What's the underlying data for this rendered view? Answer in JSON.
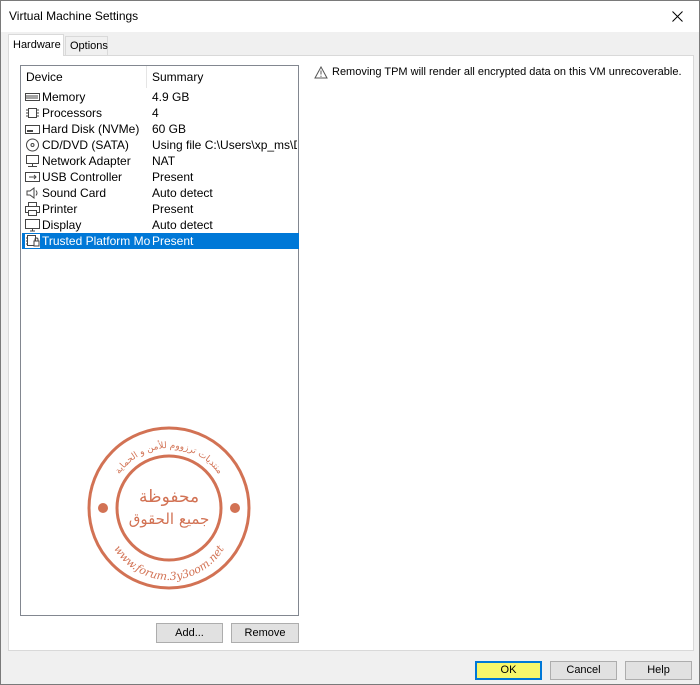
{
  "window": {
    "title": "Virtual Machine Settings"
  },
  "tabs": [
    {
      "label": "Hardware"
    },
    {
      "label": "Options"
    }
  ],
  "list": {
    "headers": {
      "device": "Device",
      "summary": "Summary"
    },
    "rows": [
      {
        "icon": "memory-icon",
        "device": "Memory",
        "summary": "4.9 GB"
      },
      {
        "icon": "processor-icon",
        "device": "Processors",
        "summary": "4"
      },
      {
        "icon": "hard-disk-icon",
        "device": "Hard Disk (NVMe)",
        "summary": "60 GB"
      },
      {
        "icon": "cd-dvd-icon",
        "device": "CD/DVD (SATA)",
        "summary": "Using file C:\\Users\\xp_ms\\D..."
      },
      {
        "icon": "network-adapter-icon",
        "device": "Network Adapter",
        "summary": "NAT"
      },
      {
        "icon": "usb-icon",
        "device": "USB Controller",
        "summary": "Present"
      },
      {
        "icon": "sound-card-icon",
        "device": "Sound Card",
        "summary": "Auto detect"
      },
      {
        "icon": "printer-icon",
        "device": "Printer",
        "summary": "Present"
      },
      {
        "icon": "display-icon",
        "device": "Display",
        "summary": "Auto detect"
      },
      {
        "icon": "tpm-icon",
        "device": "Trusted Platform Mo...",
        "summary": "Present",
        "selected": true
      }
    ]
  },
  "buttons": {
    "add": "Add...",
    "remove": "Remove",
    "ok": "OK",
    "cancel": "Cancel",
    "help": "Help"
  },
  "warning": {
    "icon": "warning-icon",
    "text": "Removing TPM will render all encrypted data on this VM unrecoverable."
  },
  "watermark": {
    "line1": "منتديات ترزووم للأمن و الحماية",
    "line2": "محفوظة",
    "line3": "جميع الحقوق",
    "url": "www.forum.3y3oom.net"
  },
  "colors": {
    "selection": "#0078d7",
    "ok_highlight": "#f7f76b",
    "stamp": "#c8502a"
  }
}
